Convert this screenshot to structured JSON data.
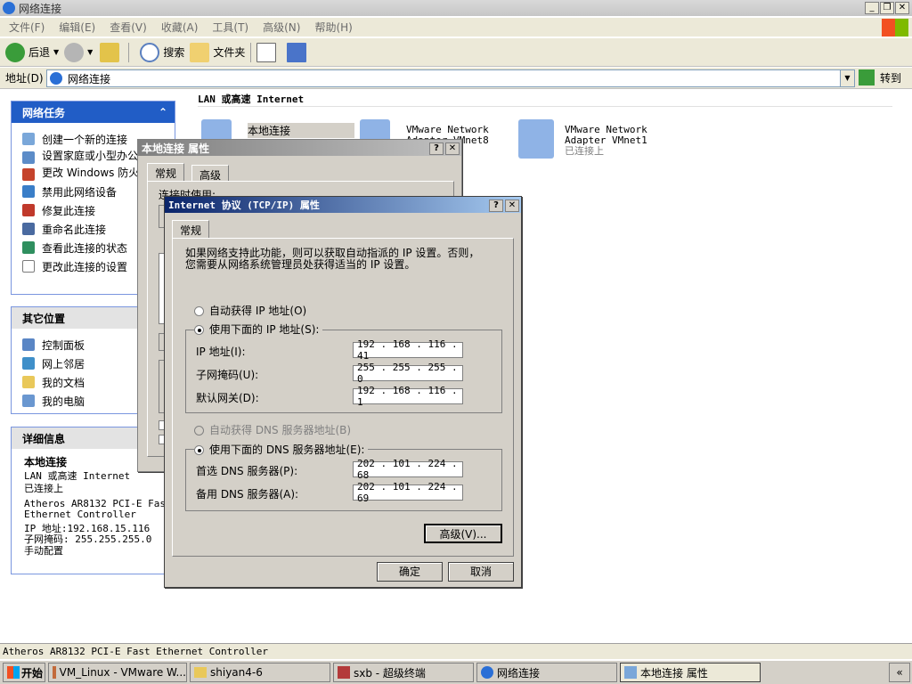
{
  "window": {
    "title": "网络连接"
  },
  "menu": [
    "文件(F)",
    "编辑(E)",
    "查看(V)",
    "收藏(A)",
    "工具(T)",
    "高级(N)",
    "帮助(H)"
  ],
  "toolbar": {
    "back": "后退",
    "search": "搜索",
    "folders": "文件夹"
  },
  "address": {
    "label": "地址(D)",
    "value": "网络连接",
    "go": "转到"
  },
  "content": {
    "group_header": "LAN 或高速 Internet"
  },
  "connections": [
    {
      "name": "本地连接"
    },
    {
      "name_line1": "VMware Network",
      "name_line2": "Adapter VMnet8"
    },
    {
      "name_line1": "VMware Network",
      "name_line2": "Adapter VMnet1",
      "status": "已连接上"
    }
  ],
  "sidebar": {
    "tasks_title": "网络任务",
    "tasks": [
      "创建一个新的连接",
      "设置家庭或小型办公室网络",
      "更改 Windows 防火墙设置",
      "禁用此网络设备",
      "修复此连接",
      "重命名此连接",
      "查看此连接的状态",
      "更改此连接的设置"
    ],
    "places_title": "其它位置",
    "places": [
      "控制面板",
      "网上邻居",
      "我的文档",
      "我的电脑"
    ],
    "details_title": "详细信息",
    "details": {
      "name": "本地连接",
      "type": "LAN 或高速 Internet",
      "status": "已连接上",
      "adapter_line1": "Atheros AR8132 PCI-E Fast",
      "adapter_line2": "Ethernet Controller",
      "ip": "IP 地址:192.168.15.116",
      "mask": "子网掩码: 255.255.255.0",
      "mode": "手动配置"
    }
  },
  "dialog_local": {
    "title": "本地连接 属性",
    "tab_general": "常规",
    "tab_advanced": "高级",
    "partial_text": "连接时使用:"
  },
  "dialog_tcpip": {
    "title": "Internet 协议 (TCP/IP) 属性",
    "tab": "常规",
    "desc_line1": "如果网络支持此功能，则可以获取自动指派的 IP 设置。否则，",
    "desc_line2": "您需要从网络系统管理员处获得适当的 IP 设置。",
    "auto_ip": "自动获得 IP 地址(O)",
    "manual_ip": "使用下面的 IP 地址(S):",
    "ip_label": "IP 地址(I):",
    "mask_label": "子网掩码(U):",
    "gw_label": "默认网关(D):",
    "ip": "192 . 168 . 116 . 41",
    "mask": "255 . 255 . 255 .  0",
    "gw": "192 . 168 . 116 .  1",
    "auto_dns": "自动获得 DNS 服务器地址(B)",
    "manual_dns": "使用下面的 DNS 服务器地址(E):",
    "dns1_label": "首选 DNS 服务器(P):",
    "dns2_label": "备用 DNS 服务器(A):",
    "dns1": "202 . 101 . 224 . 68",
    "dns2": "202 . 101 . 224 . 69",
    "advanced": "高级(V)...",
    "ok": "确定",
    "cancel": "取消"
  },
  "statusbar": {
    "text": "Atheros AR8132 PCI-E Fast Ethernet Controller"
  },
  "taskbar": {
    "start": "开始",
    "items": [
      "VM_Linux - VMware W...",
      "shiyan4-6",
      "sxb - 超级终端",
      "网络连接",
      "本地连接 属性"
    ],
    "expand": "«"
  }
}
